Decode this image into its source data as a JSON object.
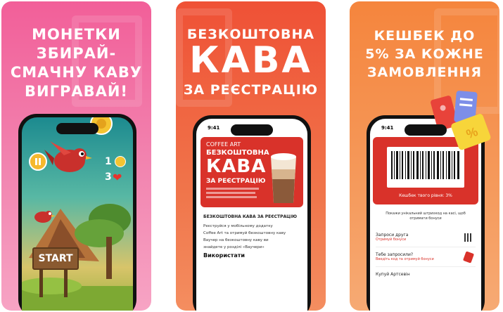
{
  "panel1": {
    "headline": [
      "МОНЕТКИ",
      "ЗБИРАЙ-",
      "СМАЧНУ КАВУ",
      "ВИГРАВАЙ!"
    ],
    "coins_count": "1",
    "lives_count": "3",
    "start_label": "START"
  },
  "panel2": {
    "headline_top": "БЕЗКОШТОВНА",
    "headline_big": "КАВА",
    "headline_bottom": "ЗА РЕЄСТРАЦІЮ",
    "status_time": "9:41",
    "banner_brand": "COFFEE ART",
    "banner_title": "БЕЗКОШТОВНА",
    "banner_big": "КАВА",
    "banner_sub": "ЗА РЕЄСТРАЦІЮ",
    "section_title": "БЕЗКОШТОВНА КАВА ЗА РЕЄСТРАЦІЮ",
    "lines": [
      "Реєструйся у мобільному додатку",
      "Coffee Art та отримуй безкоштовну каву",
      "Ваучер на безкоштовну каву ви",
      "знайдете у розділі «Ваучери»"
    ],
    "use_label": "Використати"
  },
  "panel3": {
    "headline": [
      "КЕШБЕК ДО",
      "5% ЗА КОЖНЕ",
      "ЗАМОВЛЕННЯ"
    ],
    "status_time": "9:41",
    "cashback_level": "Кешбек твого рівня: 3%",
    "instruction": "Покажи унікальний штрихкод на касі, щоб отримати бонуси",
    "menu": [
      {
        "title": "Запроси друга",
        "sub": "Отримуй бонуси"
      },
      {
        "title": "Тебе запросили?",
        "sub": "Введіть код та отримуй бонуси"
      },
      {
        "title": "Купуй Артсевін",
        "sub": ""
      }
    ]
  },
  "colors": {
    "pink": "#f25f99",
    "red": "#ef5136",
    "orange": "#f5853d",
    "banner_red": "#d9322a"
  }
}
